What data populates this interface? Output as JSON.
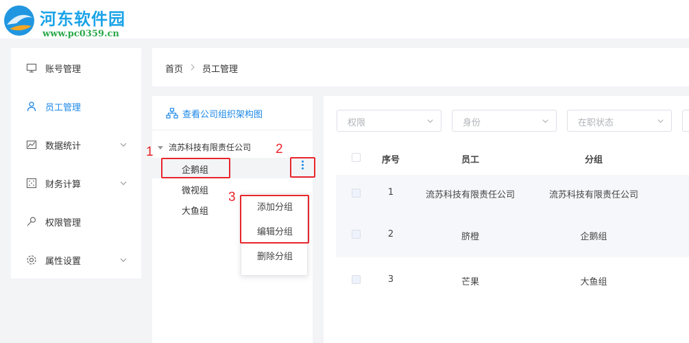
{
  "watermark": {
    "title": "河东软件园",
    "url": "www.pc0359.cn"
  },
  "sidebar": {
    "items": [
      {
        "label": "账号管理",
        "icon": "monitor-icon",
        "active": false,
        "expandable": false
      },
      {
        "label": "员工管理",
        "icon": "user-icon",
        "active": true,
        "expandable": false
      },
      {
        "label": "数据统计",
        "icon": "chart-icon",
        "active": false,
        "expandable": true
      },
      {
        "label": "财务计算",
        "icon": "calculator-icon",
        "active": false,
        "expandable": true
      },
      {
        "label": "权限管理",
        "icon": "key-icon",
        "active": false,
        "expandable": false
      },
      {
        "label": "属性设置",
        "icon": "gear-icon",
        "active": false,
        "expandable": true
      }
    ]
  },
  "breadcrumb": {
    "home": "首页",
    "current": "员工管理"
  },
  "tree": {
    "header": "查看公司组织架构图",
    "root": "流苏科技有限责任公司",
    "groups": [
      "企鹅组",
      "微视组",
      "大鱼组"
    ]
  },
  "context_menu": {
    "items": [
      "添加分组",
      "编辑分组",
      "删除分组"
    ]
  },
  "annotations": {
    "n1": "1",
    "n2": "2",
    "n3": "3"
  },
  "filters": [
    {
      "placeholder": "权限"
    },
    {
      "placeholder": "身份"
    },
    {
      "placeholder": "在职状态"
    }
  ],
  "table": {
    "headers": {
      "index": "序号",
      "employee": "员工",
      "group": "分组"
    },
    "rows": [
      {
        "index": "1",
        "employee": "流苏科技有限责任公司",
        "group": "流苏科技有限责任公司"
      },
      {
        "index": "2",
        "employee": "脐橙",
        "group": "企鹅组"
      },
      {
        "index": "3",
        "employee": "芒果",
        "group": "大鱼组"
      }
    ]
  },
  "colors": {
    "accent": "#1a87e8",
    "annotation": "#e8242a",
    "watermark_title": "#1aa3e8",
    "watermark_url": "#2aa84a"
  }
}
